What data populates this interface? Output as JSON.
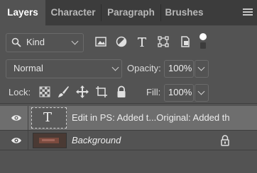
{
  "tabs": [
    {
      "label": "Layers",
      "active": true
    },
    {
      "label": "Character",
      "active": false
    },
    {
      "label": "Paragraph",
      "active": false
    },
    {
      "label": "Brushes",
      "active": false
    }
  ],
  "filter": {
    "kind_label": "Kind",
    "icons": [
      "pixel-filter-icon",
      "adjustment-filter-icon",
      "type-filter-icon",
      "shape-filter-icon",
      "smart-object-filter-icon",
      "filter-toggle-icon"
    ]
  },
  "blend": {
    "mode": "Normal",
    "opacity_label": "Opacity:",
    "opacity_value": "100%",
    "lock_label": "Lock:",
    "fill_label": "Fill:",
    "fill_value": "100%"
  },
  "layers": [
    {
      "name": "Edit in PS: Added t...Original: Added th",
      "type": "text",
      "visible": true,
      "selected": true
    },
    {
      "name": "Background",
      "type": "pixel",
      "visible": true,
      "selected": false,
      "locked": true
    }
  ],
  "colors": {
    "panel_bg": "#535353",
    "tab_bar_bg": "#3c3c3c",
    "selected_layer_bg": "#6e6e6e"
  }
}
